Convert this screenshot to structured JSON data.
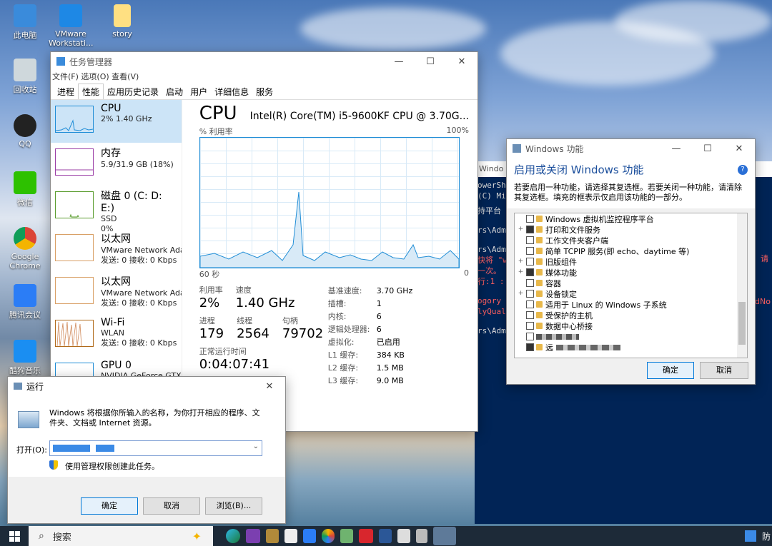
{
  "desktop_icons": [
    {
      "label": "此电脑"
    },
    {
      "label": "VMware Workstati..."
    },
    {
      "label": "story"
    },
    {
      "label": "回收站"
    },
    {
      "label": "QQ"
    },
    {
      "label": "微信"
    },
    {
      "label": "Google Chrome"
    },
    {
      "label": "腾讯会议"
    },
    {
      "label": "酷狗音乐"
    }
  ],
  "task_manager": {
    "title": "任务管理器",
    "menu": [
      "文件(F)",
      "选项(O)",
      "查看(V)"
    ],
    "tabs": [
      "进程",
      "性能",
      "应用历史记录",
      "启动",
      "用户",
      "详细信息",
      "服务"
    ],
    "active_tab": "性能",
    "sidebar": [
      {
        "name": "CPU",
        "sub1": "2% 1.40 GHz",
        "sub2": "",
        "sub3": ""
      },
      {
        "name": "内存",
        "sub1": "5.9/31.9 GB (18%)",
        "sub2": "",
        "sub3": ""
      },
      {
        "name": "磁盘 0 (C: D: E:)",
        "sub1": "SSD",
        "sub2": "0%",
        "sub3": ""
      },
      {
        "name": "以太网",
        "sub1": "VMware Network Ada",
        "sub2": "发送: 0 接收: 0 Kbps",
        "sub3": ""
      },
      {
        "name": "以太网",
        "sub1": "VMware Network Ada",
        "sub2": "发送: 0 接收: 0 Kbps",
        "sub3": ""
      },
      {
        "name": "Wi-Fi",
        "sub1": "WLAN",
        "sub2": "发送: 0 接收: 0 Kbps",
        "sub3": ""
      },
      {
        "name": "GPU 0",
        "sub1": "NVIDIA GeForce GTX",
        "sub2": "",
        "sub3": ""
      }
    ],
    "cpu_title": "CPU",
    "cpu_model": "Intel(R) Core(TM) i5-9600KF CPU @ 3.70G...",
    "graph_label_left": "% 利用率",
    "graph_label_right": "100%",
    "graph_time_left": "60 秒",
    "graph_time_right": "0",
    "stats": {
      "util_label": "利用率",
      "util": "2%",
      "speed_label": "速度",
      "speed": "1.40 GHz",
      "proc_label": "进程",
      "proc": "179",
      "threads_label": "线程",
      "threads": "2564",
      "handles_label": "句柄",
      "handles": "79702",
      "uptime_label": "正常运行时间",
      "uptime": "0:04:07:41"
    },
    "specs": [
      {
        "k": "基准速度:",
        "v": "3.70 GHz"
      },
      {
        "k": "插槽:",
        "v": "1"
      },
      {
        "k": "内核:",
        "v": "6"
      },
      {
        "k": "逻辑处理器:",
        "v": "6"
      },
      {
        "k": "虚拟化:",
        "v": "已启用"
      },
      {
        "k": "L1 缓存:",
        "v": "384 KB"
      },
      {
        "k": "L2 缓存:",
        "v": "1.5 MB"
      },
      {
        "k": "L3 缓存:",
        "v": "9.0 MB"
      }
    ]
  },
  "features": {
    "title": "Windows 功能",
    "heading": "启用或关闭 Windows 功能",
    "desc": "若要启用一种功能，请选择其复选框。若要关闭一种功能，请清除其复选框。填充的框表示仅启用该功能的一部分。",
    "items": [
      {
        "label": "Windows 虚拟机监控程序平台"
      },
      {
        "label": "打印和文件服务"
      },
      {
        "label": "工作文件夹客户端"
      },
      {
        "label": "简单 TCPIP 服务(即 echo、daytime 等)"
      },
      {
        "label": "旧版组件"
      },
      {
        "label": "媒体功能"
      },
      {
        "label": "容器"
      },
      {
        "label": "设备锁定"
      },
      {
        "label": "适用于 Linux 的 Windows 子系统"
      },
      {
        "label": "受保护的主机"
      },
      {
        "label": "数据中心桥接"
      },
      {
        "label": ""
      },
      {
        "label": "远"
      }
    ],
    "ok": "确定",
    "cancel": "取消"
  },
  "powershell": {
    "lines": [
      "Windo",
      "owerSh",
      "(C) Mi",
      "持平台",
      "rs\\Adm",
      "rs\\Adm",
      "快将 \"w",
      "一次。",
      "行:1 :",
      "ogory",
      "lyQual",
      "rs\\Adm"
    ],
    "right_text": [
      "请",
      "dNo"
    ]
  },
  "run_dialog": {
    "title": "运行",
    "desc": "Windows 将根据你所输入的名称，为你打开相应的程序、文件夹、文档或 Internet 资源。",
    "open_label": "打开(O):",
    "admin_note": "使用管理权限创建此任务。",
    "ok": "确定",
    "cancel": "取消",
    "browse": "浏览(B)..."
  },
  "taskbar": {
    "search_label": "搜索",
    "tray_text": "防"
  },
  "colors": {
    "cpu_graph": "#1f8dd6",
    "cpu_fill": "#d8eaf7",
    "mem_graph": "#9b3ea6",
    "disk_graph": "#5a9c2e",
    "net_graph": "#b06a1a",
    "accent": "#0078d7",
    "powershell_bg": "#012456"
  }
}
